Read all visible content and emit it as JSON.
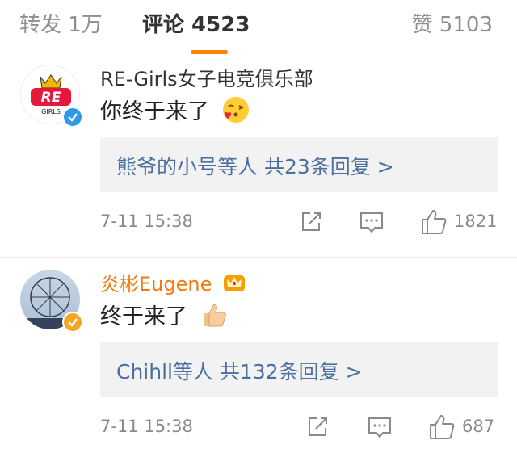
{
  "tabs": {
    "repost": "转发 1万",
    "comments": "评论 4523",
    "likes": "赞 5103"
  },
  "comments": [
    {
      "username": "RE-Girls女子电竞俱乐部",
      "text": "你终于来了",
      "emoji_icon": "blowing-kiss-emoji-icon",
      "verified": "blue",
      "replies": "熊爷的小号等人  共23条回复 >",
      "time": "7-11 15:38",
      "likes": "1821"
    },
    {
      "username": "炎彬Eugene",
      "text": "终于来了",
      "emoji_icon": "thumbs-up-emoji-icon",
      "verified": "gold",
      "replies": "Chihll等人  共132条回复 >",
      "time": "7-11 15:38",
      "likes": "687"
    }
  ],
  "colors": {
    "accent": "#ff8200",
    "link": "#4a6fa0",
    "muted": "#8a8a8a",
    "vip_name": "#f17a0c"
  }
}
